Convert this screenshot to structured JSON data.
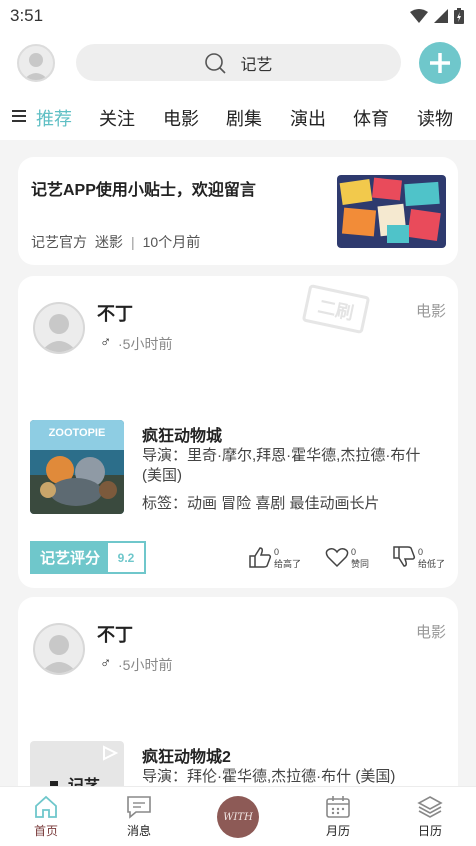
{
  "status_bar": {
    "time": "3:51"
  },
  "header": {
    "search_text": "记艺"
  },
  "tabs": [
    {
      "label": "推荐",
      "active": true
    },
    {
      "label": "关注"
    },
    {
      "label": "电影"
    },
    {
      "label": "剧集"
    },
    {
      "label": "演出"
    },
    {
      "label": "体育"
    },
    {
      "label": "读物"
    }
  ],
  "tip_card": {
    "title": "记艺APP使用小贴士，欢迎留言",
    "author": "记艺官方",
    "tag": "迷影",
    "separator": "|",
    "time": "10个月前"
  },
  "posts": [
    {
      "user": "不丁",
      "gender": "♂",
      "time": "·5小时前",
      "category": "电影",
      "stamp": "二刷",
      "movie_title": "疯狂动物城",
      "director": "导演：里奇·摩尔,拜恩·霍华德,杰拉德·布什 (美国)",
      "tags": "标签：动画 冒险 喜剧 最佳动画长片",
      "poster_text": "ZOOTOPIE",
      "score_label": "记艺评分",
      "score_value": "9.2",
      "actions": [
        {
          "icon": "thumbs-up-icon",
          "count": "0",
          "label": "给高了"
        },
        {
          "icon": "heart-icon",
          "count": "0",
          "label": "赞同"
        },
        {
          "icon": "thumbs-down-icon",
          "count": "0",
          "label": "给低了"
        }
      ]
    },
    {
      "user": "不丁",
      "gender": "♂",
      "time": "·5小时前",
      "category": "电影",
      "movie_title": "疯狂动物城2",
      "director": "导演：拜伦·霍华德,杰拉德·布什 (美国)",
      "poster_text": "记艺"
    }
  ],
  "bottom_nav": [
    {
      "label": "首页",
      "icon": "home-icon",
      "active": true
    },
    {
      "label": "消息",
      "icon": "message-icon"
    },
    {
      "label": "WITH",
      "icon": "with-logo"
    },
    {
      "label": "月历",
      "icon": "calendar-icon"
    },
    {
      "label": "日历",
      "icon": "layers-icon"
    }
  ],
  "colors": {
    "accent": "#6fc7cb",
    "active_tab": "#5fbfc4",
    "nav_active": "#7a3b3b",
    "with_button": "#8d5a56"
  }
}
